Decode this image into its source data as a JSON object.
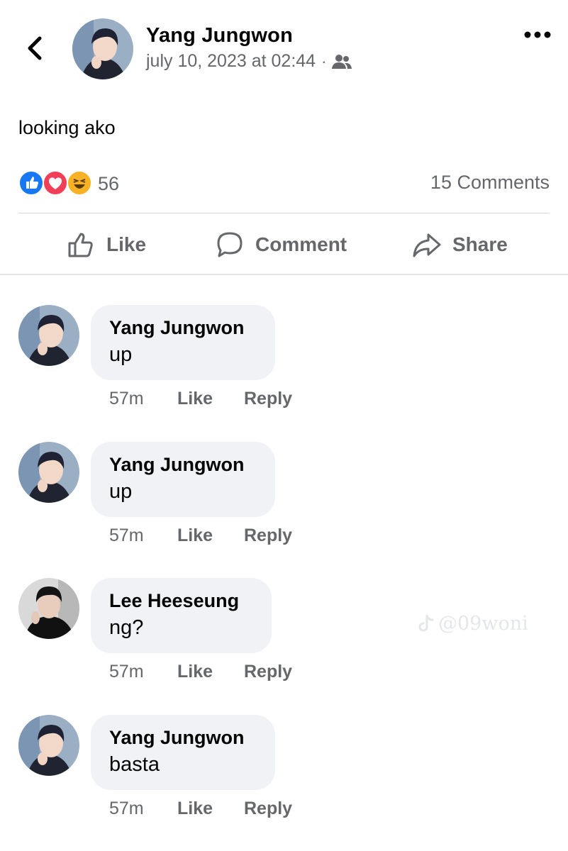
{
  "post": {
    "author": "Yang Jungwon",
    "timestamp": "july 10, 2023 at 02:44",
    "separator": "·",
    "audience_icon": "friends-icon",
    "text": "looking ako",
    "reaction_icons": [
      "like-reaction-icon",
      "love-reaction-icon",
      "haha-reaction-icon"
    ],
    "reaction_count": "56",
    "comments_count": "15 Comments"
  },
  "actions": {
    "like": "Like",
    "comment": "Comment",
    "share": "Share"
  },
  "comments": [
    {
      "author": "Yang Jungwon",
      "text": "up",
      "time": "57m",
      "like": "Like",
      "reply": "Reply"
    },
    {
      "author": "Yang Jungwon",
      "text": "up",
      "time": "57m",
      "like": "Like",
      "reply": "Reply"
    },
    {
      "author": "Lee Heeseung",
      "text": "ng?",
      "time": "57m",
      "like": "Like",
      "reply": "Reply"
    },
    {
      "author": "Yang Jungwon",
      "text": "basta",
      "time": "57m",
      "like": "Like",
      "reply": "Reply"
    }
  ],
  "watermark": "@09woni",
  "colors": {
    "secondary_text": "#65676b",
    "bubble": "#f0f2f5",
    "like_blue": "#1877f2",
    "love_red": "#f33e58",
    "haha_yellow": "#f7b125"
  }
}
